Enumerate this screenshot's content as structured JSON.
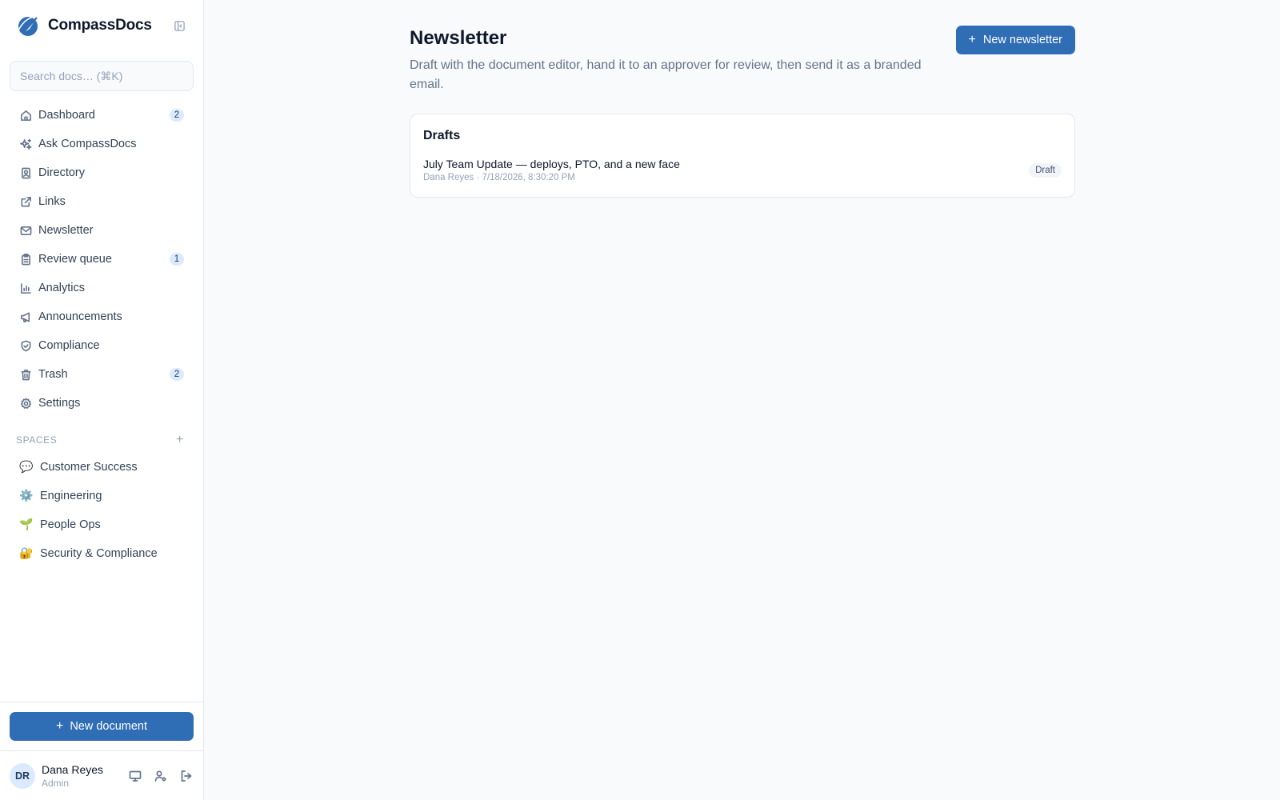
{
  "brand": {
    "name": "CompassDocs"
  },
  "search": {
    "placeholder": "Search docs… (⌘K)"
  },
  "nav": {
    "items": [
      {
        "label": "Dashboard",
        "badge": "2"
      },
      {
        "label": "Ask CompassDocs"
      },
      {
        "label": "Directory"
      },
      {
        "label": "Links"
      },
      {
        "label": "Newsletter"
      },
      {
        "label": "Review queue",
        "badge": "1"
      },
      {
        "label": "Analytics"
      },
      {
        "label": "Announcements"
      },
      {
        "label": "Compliance"
      },
      {
        "label": "Trash",
        "badge": "2"
      },
      {
        "label": "Settings"
      }
    ]
  },
  "spaces": {
    "heading": "SPACES",
    "add_label": "+",
    "items": [
      {
        "emoji": "💬",
        "label": "Customer Success"
      },
      {
        "emoji": "⚙️",
        "label": "Engineering"
      },
      {
        "emoji": "🌱",
        "label": "People Ops"
      },
      {
        "emoji": "🔐",
        "label": "Security & Compliance"
      }
    ]
  },
  "sidebar_footer": {
    "new_document_label": "New document",
    "user": {
      "initials": "DR",
      "name": "Dana Reyes",
      "role": "Admin"
    }
  },
  "page": {
    "title": "Newsletter",
    "subtitle": "Draft with the document editor, hand it to an approver for review, then send it as a branded email.",
    "new_button_label": "New newsletter"
  },
  "drafts": {
    "heading": "Drafts",
    "items": [
      {
        "title": "July Team Update — deploys, PTO, and a new face",
        "meta": "Dana Reyes · 7/18/2026, 8:30:20 PM",
        "status": "Draft"
      }
    ]
  },
  "colors": {
    "accent": "#2f6db5",
    "badge_bg": "#dbeafe",
    "page_bg": "#f8fafc"
  }
}
